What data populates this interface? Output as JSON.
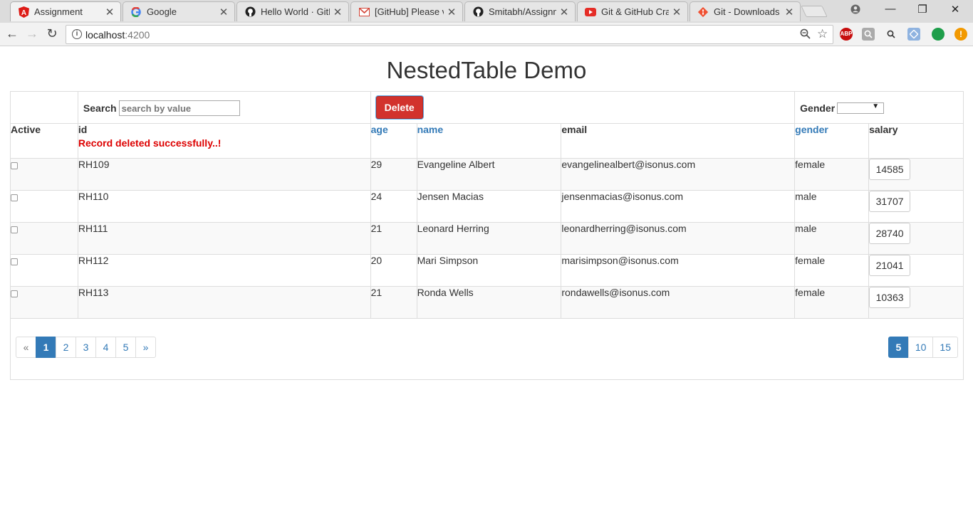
{
  "browser": {
    "tabs": [
      {
        "title": "Assignment",
        "icon": "angular-icon",
        "active": true
      },
      {
        "title": "Google",
        "icon": "google-icon",
        "active": false
      },
      {
        "title": "Hello World · GitH",
        "icon": "github-icon",
        "active": false
      },
      {
        "title": "[GitHub] Please ve",
        "icon": "gmail-icon",
        "active": false
      },
      {
        "title": "Smitabh/Assignme",
        "icon": "github-icon",
        "active": false
      },
      {
        "title": "Git & GitHub Cras",
        "icon": "youtube-icon",
        "active": false
      },
      {
        "title": "Git - Downloads",
        "icon": "git-icon",
        "active": false
      }
    ],
    "address": {
      "host": "localhost",
      "port": ":4200"
    },
    "extensions": [
      "ABP"
    ]
  },
  "page": {
    "title": "NestedTable Demo"
  },
  "filters": {
    "search_label": "Search",
    "search_placeholder": "search by value",
    "delete_label": "Delete",
    "gender_label": "Gender"
  },
  "columns": {
    "active": "Active",
    "id": "id",
    "age": "age",
    "name": "name",
    "email": "email",
    "gender": "gender",
    "salary": "salary"
  },
  "status_message": "Record deleted successfully..!",
  "rows": [
    {
      "id": "RH109",
      "age": "29",
      "name": "Evangeline Albert",
      "email": "evangelinealbert@isonus.com",
      "gender": "female",
      "salary": "14585"
    },
    {
      "id": "RH110",
      "age": "24",
      "name": "Jensen Macias",
      "email": "jensenmacias@isonus.com",
      "gender": "male",
      "salary": "31707"
    },
    {
      "id": "RH111",
      "age": "21",
      "name": "Leonard Herring",
      "email": "leonardherring@isonus.com",
      "gender": "male",
      "salary": "28740"
    },
    {
      "id": "RH112",
      "age": "20",
      "name": "Mari Simpson",
      "email": "marisimpson@isonus.com",
      "gender": "female",
      "salary": "21041"
    },
    {
      "id": "RH113",
      "age": "21",
      "name": "Ronda Wells",
      "email": "rondawells@isonus.com",
      "gender": "female",
      "salary": "10363"
    }
  ],
  "pagination": {
    "prev": "«",
    "pages": [
      "1",
      "2",
      "3",
      "4",
      "5"
    ],
    "current": "1",
    "next": "»"
  },
  "page_size": {
    "options": [
      "5",
      "10",
      "15"
    ],
    "current": "5"
  },
  "colors": {
    "accent": "#337ab7",
    "danger": "#d2322d",
    "message": "#dd0000"
  }
}
